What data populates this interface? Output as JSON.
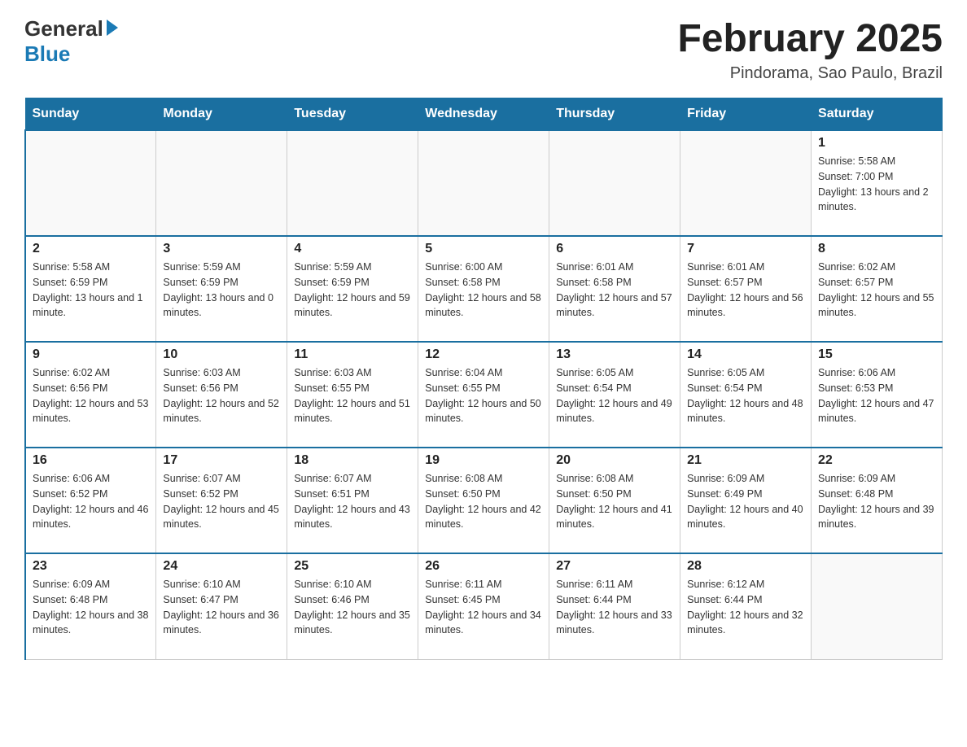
{
  "logo": {
    "general": "General",
    "blue": "Blue"
  },
  "header": {
    "title": "February 2025",
    "location": "Pindorama, Sao Paulo, Brazil"
  },
  "days_of_week": [
    "Sunday",
    "Monday",
    "Tuesday",
    "Wednesday",
    "Thursday",
    "Friday",
    "Saturday"
  ],
  "weeks": [
    {
      "days": [
        {
          "num": "",
          "info": ""
        },
        {
          "num": "",
          "info": ""
        },
        {
          "num": "",
          "info": ""
        },
        {
          "num": "",
          "info": ""
        },
        {
          "num": "",
          "info": ""
        },
        {
          "num": "",
          "info": ""
        },
        {
          "num": "1",
          "info": "Sunrise: 5:58 AM\nSunset: 7:00 PM\nDaylight: 13 hours and 2 minutes."
        }
      ]
    },
    {
      "days": [
        {
          "num": "2",
          "info": "Sunrise: 5:58 AM\nSunset: 6:59 PM\nDaylight: 13 hours and 1 minute."
        },
        {
          "num": "3",
          "info": "Sunrise: 5:59 AM\nSunset: 6:59 PM\nDaylight: 13 hours and 0 minutes."
        },
        {
          "num": "4",
          "info": "Sunrise: 5:59 AM\nSunset: 6:59 PM\nDaylight: 12 hours and 59 minutes."
        },
        {
          "num": "5",
          "info": "Sunrise: 6:00 AM\nSunset: 6:58 PM\nDaylight: 12 hours and 58 minutes."
        },
        {
          "num": "6",
          "info": "Sunrise: 6:01 AM\nSunset: 6:58 PM\nDaylight: 12 hours and 57 minutes."
        },
        {
          "num": "7",
          "info": "Sunrise: 6:01 AM\nSunset: 6:57 PM\nDaylight: 12 hours and 56 minutes."
        },
        {
          "num": "8",
          "info": "Sunrise: 6:02 AM\nSunset: 6:57 PM\nDaylight: 12 hours and 55 minutes."
        }
      ]
    },
    {
      "days": [
        {
          "num": "9",
          "info": "Sunrise: 6:02 AM\nSunset: 6:56 PM\nDaylight: 12 hours and 53 minutes."
        },
        {
          "num": "10",
          "info": "Sunrise: 6:03 AM\nSunset: 6:56 PM\nDaylight: 12 hours and 52 minutes."
        },
        {
          "num": "11",
          "info": "Sunrise: 6:03 AM\nSunset: 6:55 PM\nDaylight: 12 hours and 51 minutes."
        },
        {
          "num": "12",
          "info": "Sunrise: 6:04 AM\nSunset: 6:55 PM\nDaylight: 12 hours and 50 minutes."
        },
        {
          "num": "13",
          "info": "Sunrise: 6:05 AM\nSunset: 6:54 PM\nDaylight: 12 hours and 49 minutes."
        },
        {
          "num": "14",
          "info": "Sunrise: 6:05 AM\nSunset: 6:54 PM\nDaylight: 12 hours and 48 minutes."
        },
        {
          "num": "15",
          "info": "Sunrise: 6:06 AM\nSunset: 6:53 PM\nDaylight: 12 hours and 47 minutes."
        }
      ]
    },
    {
      "days": [
        {
          "num": "16",
          "info": "Sunrise: 6:06 AM\nSunset: 6:52 PM\nDaylight: 12 hours and 46 minutes."
        },
        {
          "num": "17",
          "info": "Sunrise: 6:07 AM\nSunset: 6:52 PM\nDaylight: 12 hours and 45 minutes."
        },
        {
          "num": "18",
          "info": "Sunrise: 6:07 AM\nSunset: 6:51 PM\nDaylight: 12 hours and 43 minutes."
        },
        {
          "num": "19",
          "info": "Sunrise: 6:08 AM\nSunset: 6:50 PM\nDaylight: 12 hours and 42 minutes."
        },
        {
          "num": "20",
          "info": "Sunrise: 6:08 AM\nSunset: 6:50 PM\nDaylight: 12 hours and 41 minutes."
        },
        {
          "num": "21",
          "info": "Sunrise: 6:09 AM\nSunset: 6:49 PM\nDaylight: 12 hours and 40 minutes."
        },
        {
          "num": "22",
          "info": "Sunrise: 6:09 AM\nSunset: 6:48 PM\nDaylight: 12 hours and 39 minutes."
        }
      ]
    },
    {
      "days": [
        {
          "num": "23",
          "info": "Sunrise: 6:09 AM\nSunset: 6:48 PM\nDaylight: 12 hours and 38 minutes."
        },
        {
          "num": "24",
          "info": "Sunrise: 6:10 AM\nSunset: 6:47 PM\nDaylight: 12 hours and 36 minutes."
        },
        {
          "num": "25",
          "info": "Sunrise: 6:10 AM\nSunset: 6:46 PM\nDaylight: 12 hours and 35 minutes."
        },
        {
          "num": "26",
          "info": "Sunrise: 6:11 AM\nSunset: 6:45 PM\nDaylight: 12 hours and 34 minutes."
        },
        {
          "num": "27",
          "info": "Sunrise: 6:11 AM\nSunset: 6:44 PM\nDaylight: 12 hours and 33 minutes."
        },
        {
          "num": "28",
          "info": "Sunrise: 6:12 AM\nSunset: 6:44 PM\nDaylight: 12 hours and 32 minutes."
        },
        {
          "num": "",
          "info": ""
        }
      ]
    }
  ]
}
